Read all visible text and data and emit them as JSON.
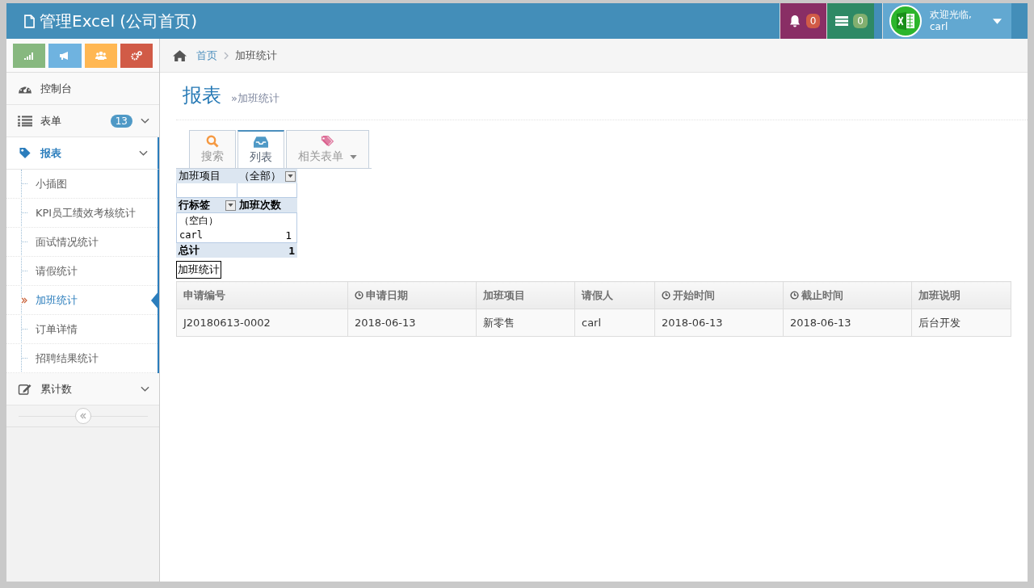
{
  "header": {
    "title": "管理Excel (公司首页)",
    "notifications": [
      {
        "kind": "bell",
        "count": "0",
        "color": "#892e65"
      },
      {
        "kind": "tasks",
        "count": "0",
        "color": "#2e8965"
      }
    ],
    "user": {
      "greeting": "欢迎光临,",
      "name": "carl"
    }
  },
  "shortcuts": [
    {
      "kind": "signal",
      "color": "#87b87f"
    },
    {
      "kind": "bullhorn",
      "color": "#6fb3e0"
    },
    {
      "kind": "users",
      "color": "#ffb752"
    },
    {
      "kind": "cogs",
      "color": "#d15b47"
    }
  ],
  "sidebar": {
    "items": [
      {
        "kind": "dashboard",
        "label": "控制台",
        "selected": false
      },
      {
        "kind": "list",
        "label": "表单",
        "badge": "13",
        "selected": false
      },
      {
        "kind": "tag",
        "label": "报表",
        "selected": true,
        "children": [
          {
            "label": "小插图",
            "selected": false
          },
          {
            "label": "KPI员工绩效考核统计",
            "selected": false
          },
          {
            "label": "面试情况统计",
            "selected": false
          },
          {
            "label": "请假统计",
            "selected": false
          },
          {
            "label": "加班统计",
            "selected": true
          },
          {
            "label": "订单详情",
            "selected": false
          },
          {
            "label": "招聘结果统计",
            "selected": false
          }
        ]
      },
      {
        "kind": "edit",
        "label": "累计数",
        "selected": false
      }
    ]
  },
  "breadcrumb": [
    {
      "kind": "home",
      "label": "首页"
    },
    {
      "kind": "current",
      "label": "加班统计"
    }
  ],
  "page_header": {
    "title": "报表",
    "subtitle": "»加班统计"
  },
  "tabs": [
    {
      "kind": "search",
      "label": "搜索",
      "selected": false
    },
    {
      "kind": "list",
      "label": "列表",
      "selected": true
    },
    {
      "kind": "tags",
      "label": "相关表单",
      "selected": false
    }
  ],
  "pivot": {
    "filter": {
      "label": "加班项目",
      "value": "（全部）"
    },
    "header": [
      "行标签",
      "加班次数"
    ],
    "rows": [
      {
        "label": "（空白）"
      },
      {
        "label": "carl",
        "value": "1"
      }
    ],
    "total": {
      "label": "总计",
      "value": "1"
    },
    "caption": "加班统计"
  },
  "table": {
    "columns": [
      {
        "label": "申请编号",
        "clock": false
      },
      {
        "label": "申请日期",
        "clock": true
      },
      {
        "label": "加班项目",
        "clock": false
      },
      {
        "label": "请假人",
        "clock": false
      },
      {
        "label": "开始时间",
        "clock": true
      },
      {
        "label": "截止时间",
        "clock": true
      },
      {
        "label": "加班说明",
        "clock": false
      }
    ],
    "rows": [
      [
        "J20180613-0002",
        "2018-06-13",
        "新零售",
        "carl",
        "2018-06-13",
        "2018-06-13",
        "后台开发"
      ]
    ]
  }
}
